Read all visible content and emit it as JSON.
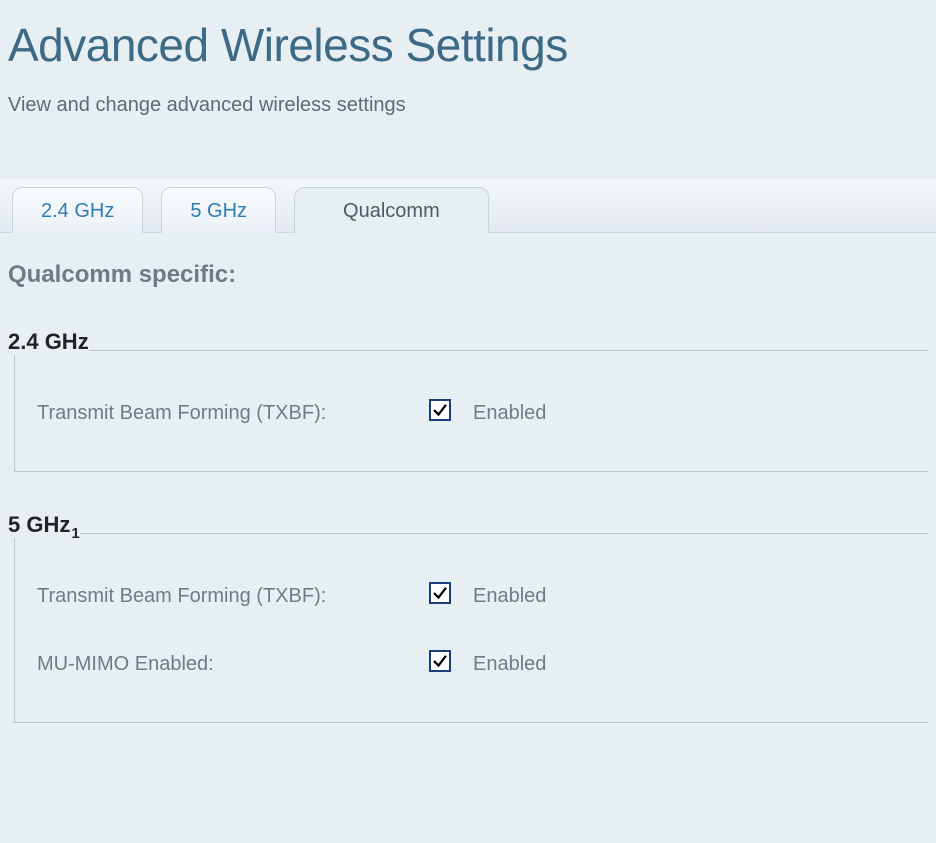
{
  "header": {
    "title": "Advanced Wireless Settings",
    "subtitle": "View and change advanced wireless settings"
  },
  "tabs": {
    "t0": "2.4 GHz",
    "t1": "5 GHz",
    "t2": "Qualcomm"
  },
  "section": {
    "title": "Qualcomm specific:"
  },
  "band24": {
    "label": "2.4 GHz",
    "txbf_label": "Transmit Beam Forming (TXBF):",
    "txbf_value": "Enabled"
  },
  "band5": {
    "label": "5 GHz",
    "sub": "1",
    "txbf_label": "Transmit Beam Forming (TXBF):",
    "txbf_value": "Enabled",
    "mumimo_label": "MU-MIMO Enabled:",
    "mumimo_value": "Enabled"
  }
}
